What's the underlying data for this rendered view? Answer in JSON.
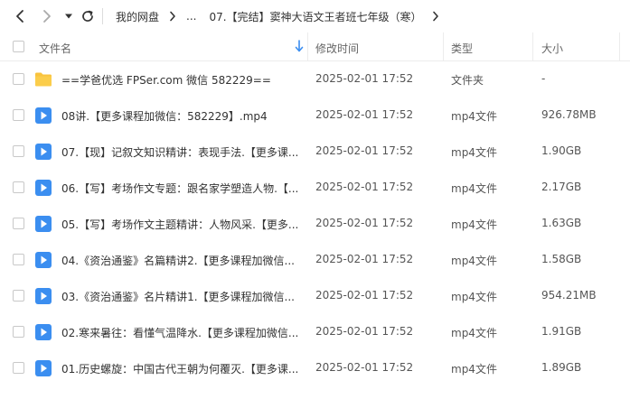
{
  "toolbar": {
    "back_icon": "chevron-left-icon",
    "forward_icon": "chevron-right-icon",
    "history_icon": "caret-down-icon",
    "refresh_icon": "refresh-icon"
  },
  "breadcrumb": {
    "root": "我的网盘",
    "ellipsis": "...",
    "current": "07.【完结】窦神大语文王者班七年级（寒）"
  },
  "columns": {
    "name": "文件名",
    "modified": "修改时间",
    "type": "类型",
    "size": "大小",
    "sort_icon": "sort-down-arrow-icon"
  },
  "colors": {
    "accent": "#3b8ef0",
    "folder": "#f9c33d",
    "video": "#3b8ef0"
  },
  "files": [
    {
      "name": "==学爸优选 FPSer.com 微信 582229==",
      "date": "2025-02-01 17:52",
      "type": "文件夹",
      "size": "-",
      "icon": "folder-icon"
    },
    {
      "name": "08讲.【更多课程加微信：582229】.mp4",
      "date": "2025-02-01 17:52",
      "type": "mp4文件",
      "size": "926.78MB",
      "icon": "video-file-icon"
    },
    {
      "name": "07.【现】记叙文知识精讲：表现手法.【更多课...",
      "date": "2025-02-01 17:52",
      "type": "mp4文件",
      "size": "1.90GB",
      "icon": "video-file-icon"
    },
    {
      "name": "06.【写】考场作文专题：跟名家学塑造人物.【...",
      "date": "2025-02-01 17:52",
      "type": "mp4文件",
      "size": "2.17GB",
      "icon": "video-file-icon"
    },
    {
      "name": "05.【写】考场作文主题精讲：人物风采.【更多...",
      "date": "2025-02-01 17:52",
      "type": "mp4文件",
      "size": "1.63GB",
      "icon": "video-file-icon"
    },
    {
      "name": "04.《资治通鉴》名篇精讲2.【更多课程加微信...",
      "date": "2025-02-01 17:52",
      "type": "mp4文件",
      "size": "1.58GB",
      "icon": "video-file-icon"
    },
    {
      "name": "03.《资治通鉴》名片精讲1.【更多课程加微信...",
      "date": "2025-02-01 17:52",
      "type": "mp4文件",
      "size": "954.21MB",
      "icon": "video-file-icon"
    },
    {
      "name": "02.寒来暑往：看懂气温降水.【更多课程加微信...",
      "date": "2025-02-01 17:52",
      "type": "mp4文件",
      "size": "1.91GB",
      "icon": "video-file-icon"
    },
    {
      "name": "01.历史螺旋：中国古代王朝为何覆灭.【更多课...",
      "date": "2025-02-01 17:52",
      "type": "mp4文件",
      "size": "1.89GB",
      "icon": "video-file-icon"
    }
  ]
}
